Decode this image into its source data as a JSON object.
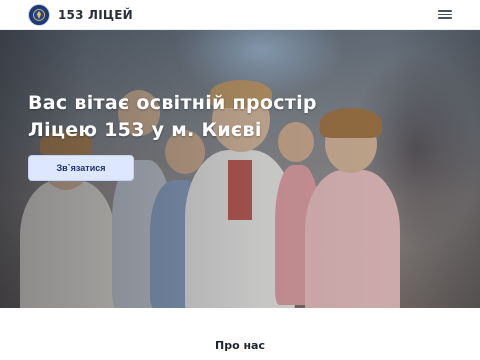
{
  "navbar": {
    "brand": "153 ЛІЦЕЙ",
    "logo_icon": "school-emblem-icon",
    "menu_icon": "hamburger-menu-icon"
  },
  "hero": {
    "title": "Вас вітає освітній простір Ліцею 153 у м. Києві",
    "cta_label": "Зв`язатися",
    "image_description_icon": "hero-photo"
  },
  "about": {
    "title": "Про нас"
  },
  "colors": {
    "brand_text": "#2a2f3a",
    "cta_background": "#dde7ff",
    "cta_text": "#1f2f6e",
    "hero_text": "#ffffff"
  }
}
